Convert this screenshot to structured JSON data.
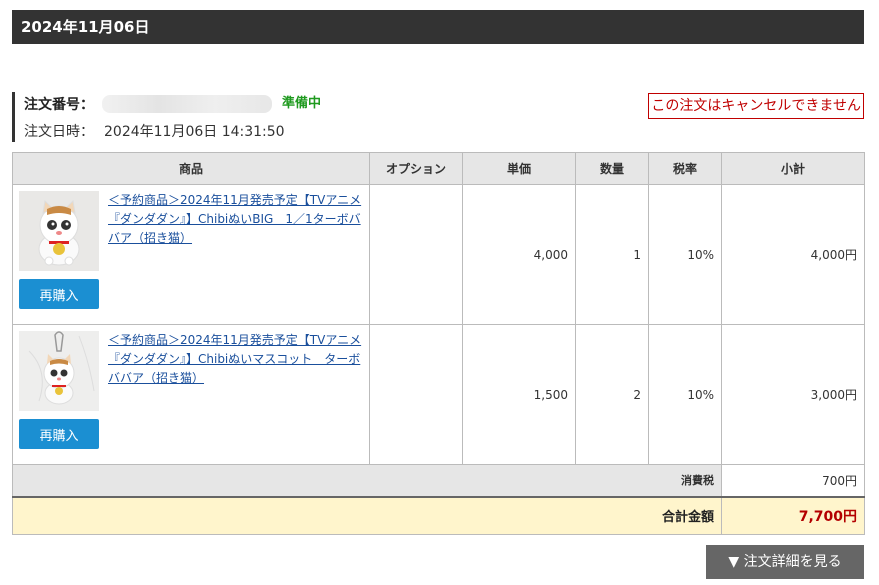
{
  "header": {
    "date": "2024年11月06日"
  },
  "order": {
    "number_label": "注文番号：",
    "status": "準備中",
    "date_label": "注文日時：",
    "date_value": "2024年11月06日 14:31:50",
    "cancel_note": "この注文はキャンセルできません"
  },
  "table": {
    "headers": [
      "商品",
      "オプション",
      "単価",
      "数量",
      "税率",
      "小計"
    ],
    "items": [
      {
        "name": "＜予約商品＞2024年11月発売予定【TVアニメ『ダンダダン』】ChibiぬいBIG　1／1ターボババア（招き猫）",
        "option": "",
        "price": "4,000",
        "qty": "1",
        "tax": "10%",
        "subtotal": "4,000円",
        "rebuy_label": "再購入"
      },
      {
        "name": "＜予約商品＞2024年11月発売予定【TVアニメ『ダンダダン』】Chibiぬいマスコット　ターボババア（招き猫）",
        "option": "",
        "price": "1,500",
        "qty": "2",
        "tax": "10%",
        "subtotal": "3,000円",
        "rebuy_label": "再購入"
      }
    ],
    "tax_label": "消費税",
    "tax_value": "700円",
    "total_label": "合計金額",
    "total_value": "7,700円"
  },
  "detail_button": "▼ 注文詳細を見る",
  "colors": {
    "status": "#1f9a1f",
    "cancel": "#c00000",
    "button": "#1b8fd2",
    "total": "#b30000",
    "header_bg": "#333333"
  }
}
